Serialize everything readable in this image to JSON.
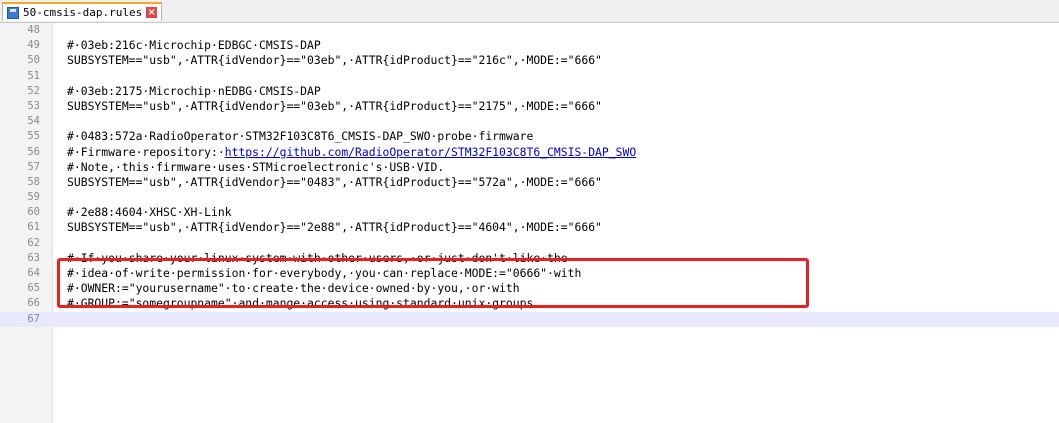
{
  "tab": {
    "label": "50-cmsis-dap.rules",
    "icon": "save-disk-icon",
    "close": "×"
  },
  "colors": {
    "highlight": "#e62222",
    "current_line": "#e8e8ff",
    "tab_accent": "#f5a623"
  },
  "lines": [
    {
      "n": "48",
      "text": ""
    },
    {
      "n": "49",
      "text": "#·03eb:216c·Microchip·EDBGC·CMSIS-DAP"
    },
    {
      "n": "50",
      "text": "SUBSYSTEM==\"usb\",·ATTR{idVendor}==\"03eb\",·ATTR{idProduct}==\"216c\",·MODE:=\"666\""
    },
    {
      "n": "51",
      "text": ""
    },
    {
      "n": "52",
      "text": "#·03eb:2175·Microchip·nEDBG·CMSIS-DAP"
    },
    {
      "n": "53",
      "text": "SUBSYSTEM==\"usb\",·ATTR{idVendor}==\"03eb\",·ATTR{idProduct}==\"2175\",·MODE:=\"666\""
    },
    {
      "n": "54",
      "text": ""
    },
    {
      "n": "55",
      "text": "#·0483:572a·RadioOperator·STM32F103C8T6_CMSIS-DAP_SWO·probe·firmware"
    },
    {
      "n": "56",
      "text": "#·Firmware·repository:·",
      "link": "https://github.com/RadioOperator/STM32F103C8T6_CMSIS-DAP_SWO"
    },
    {
      "n": "57",
      "text": "#·Note,·this·firmware·uses·STMicroelectronic's·USB·VID."
    },
    {
      "n": "58",
      "text": "SUBSYSTEM==\"usb\",·ATTR{idVendor}==\"0483\",·ATTR{idProduct}==\"572a\",·MODE:=\"666\""
    },
    {
      "n": "59",
      "text": ""
    },
    {
      "n": "60",
      "text": "#·2e88:4604·XHSC·XH-Link"
    },
    {
      "n": "61",
      "text": "SUBSYSTEM==\"usb\",·ATTR{idVendor}==\"2e88\",·ATTR{idProduct}==\"4604\",·MODE:=\"666\""
    },
    {
      "n": "62",
      "text": ""
    },
    {
      "n": "63",
      "text": "#·If·you·share·your·linux·system·with·other·users,·or·just·don't·like·the"
    },
    {
      "n": "64",
      "text": "#·idea·of·write·permission·for·everybody,·you·can·replace·MODE:=\"0666\"·with"
    },
    {
      "n": "65",
      "text": "#·OWNER:=\"yourusername\"·to·create·the·device·owned·by·you,·or·with"
    },
    {
      "n": "66",
      "text": "#·GROUP:=\"somegroupname\"·and·mange·access·using·standard·unix·groups."
    },
    {
      "n": "67",
      "text": "",
      "current": true
    }
  ]
}
